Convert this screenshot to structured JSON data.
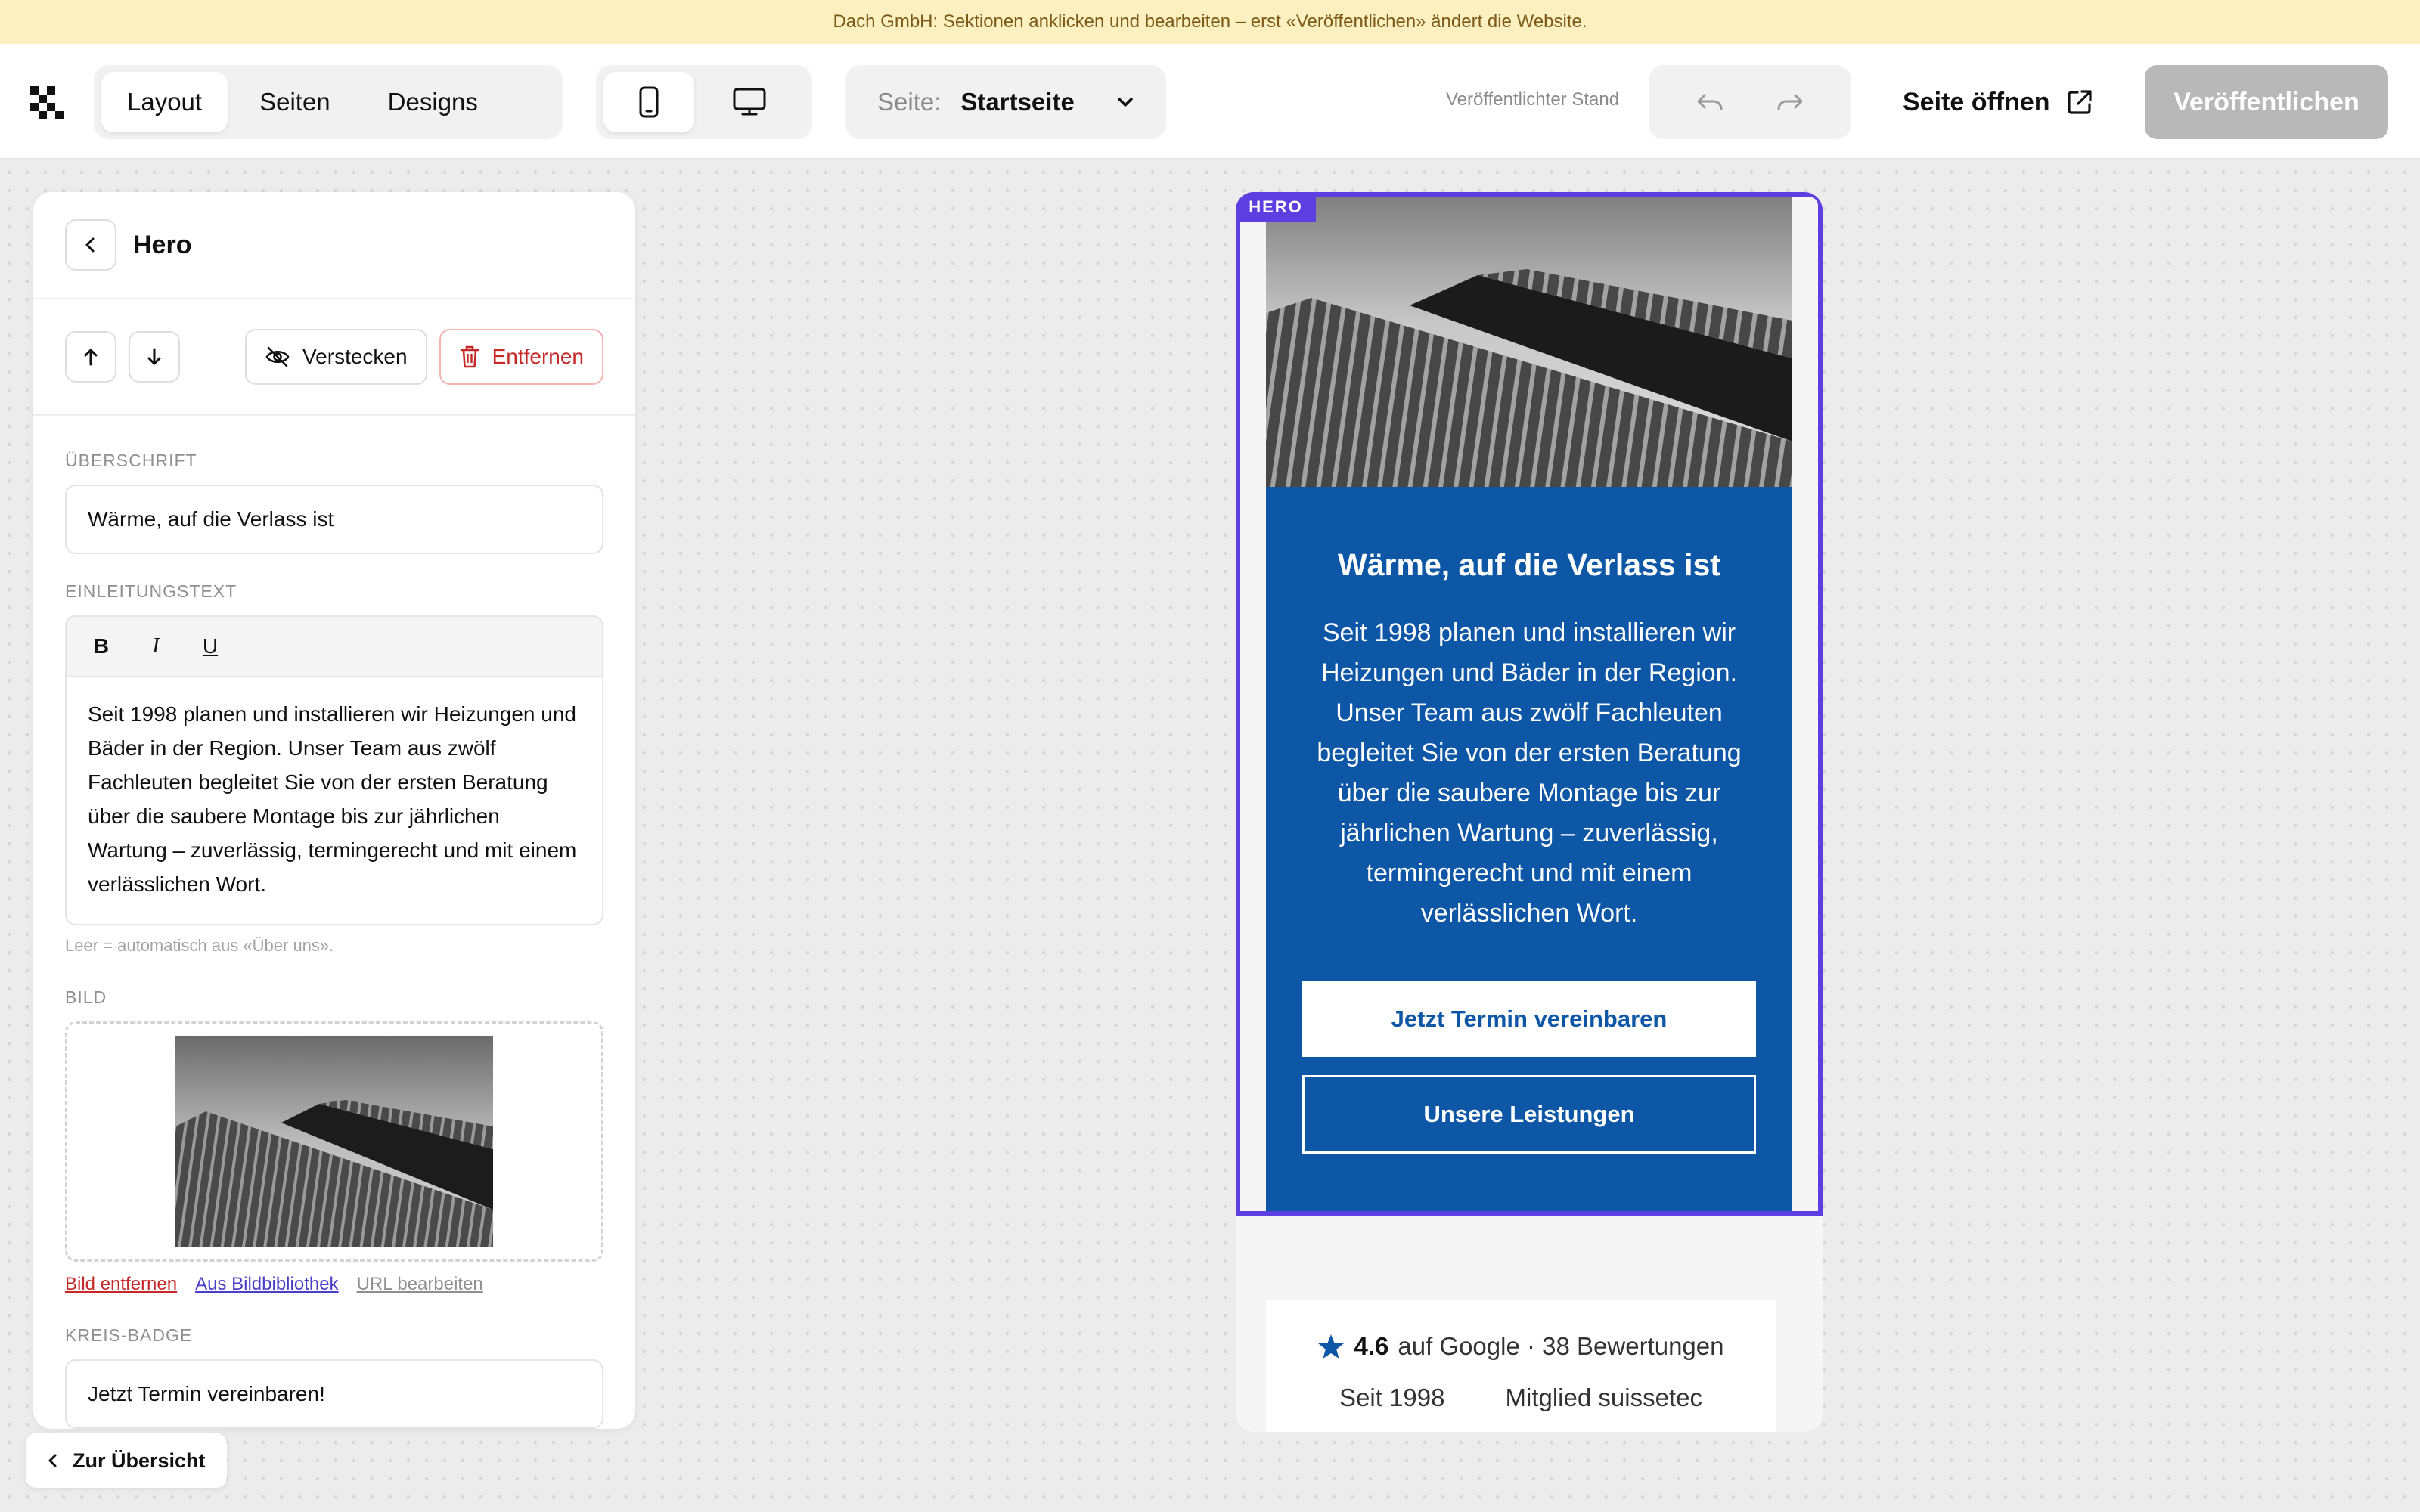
{
  "notice": "Dach GmbH: Sektionen anklicken und bearbeiten – erst «Veröffentlichen» ändert die Website.",
  "nav": {
    "tabs": [
      "Layout",
      "Seiten",
      "Designs"
    ],
    "active_tab": "Layout"
  },
  "device": {
    "options": [
      "mobile-icon",
      "desktop-icon"
    ],
    "active": "mobile"
  },
  "page_select": {
    "label": "Seite:",
    "value": "Startseite"
  },
  "publish_state": "Veröffentlichter Stand",
  "open_page": "Seite öffnen",
  "publish": "Veröffentlichen",
  "colors": {
    "accent": "#5b3fe0",
    "hero_blue": "#0e57a6",
    "danger": "#c62828",
    "notice_bg": "#fcefc0"
  },
  "panel": {
    "title": "Hero",
    "hide": "Verstecken",
    "remove": "Entfernen",
    "heading_label": "ÜBERSCHRIFT",
    "heading_value": "Wärme, auf die Verlass ist",
    "intro_label": "EINLEITUNGSTEXT",
    "format": {
      "bold": "B",
      "italic": "I",
      "underline": "U"
    },
    "intro_value": "Seit 1998 planen und installieren wir Heizungen und Bäder in der Region. Unser Team aus zwölf Fachleuten begleitet Sie von der ersten Beratung über die saubere Montage bis zur jährlichen Wartung – zuverlässig, termingerecht und mit einem verlässlichen Wort.",
    "intro_hint": "Leer = automatisch aus «Über uns».",
    "image_label": "BILD",
    "image_links": {
      "remove": "Bild entfernen",
      "library": "Aus Bildbibliothek",
      "url": "URL bearbeiten"
    },
    "badge_label": "KREIS-BADGE",
    "badge_value": "Jetzt Termin vereinbaren!"
  },
  "back": "Zur Übersicht",
  "preview": {
    "tag": "HERO",
    "heading": "Wärme, auf die Verlass ist",
    "text": "Seit 1998 planen und installieren wir Heizungen und Bäder in der Region. Unser Team aus zwölf Fachleuten begleitet Sie von der ersten Beratung über die saubere Montage bis zur jährlichen Wartung – zuverlässig, termingerecht und mit einem verlässlichen Wort.",
    "cta_primary": "Jetzt Termin vereinbaren",
    "cta_secondary": "Unsere Leistungen",
    "rating_value": "4.6",
    "rating_text": "auf Google · 38 Bewertungen",
    "since": "Seit 1998",
    "member": "Mitglied suissetec"
  }
}
